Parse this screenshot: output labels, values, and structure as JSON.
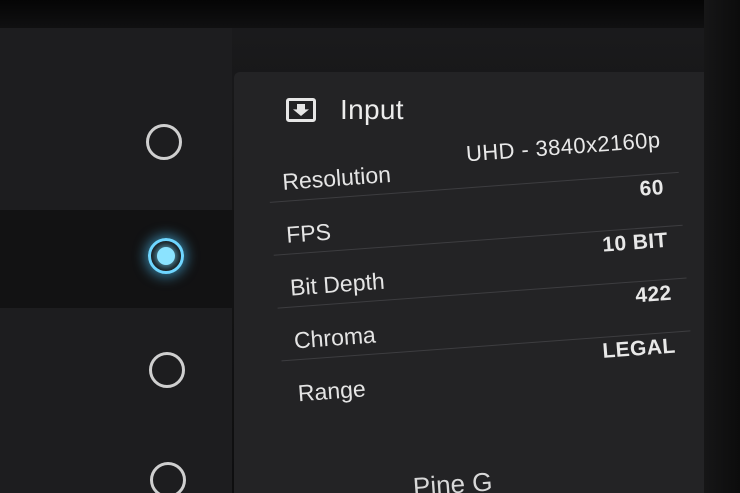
{
  "panel": {
    "title": "Input",
    "icon": "input-download-icon"
  },
  "settings": [
    {
      "label": "Resolution",
      "value": "UHD - 3840x2160p"
    },
    {
      "label": "FPS",
      "value": "60"
    },
    {
      "label": "Bit Depth",
      "value": "10 BIT"
    },
    {
      "label": "Chroma",
      "value": "422"
    },
    {
      "label": "Range",
      "value": "LEGAL"
    }
  ],
  "radio_selector": {
    "options": 4,
    "selected_index": 1
  },
  "footer": {
    "partial_label": "Pine G"
  },
  "colors": {
    "accent": "#6fd6ff",
    "panel_bg": "#232325",
    "text": "#e8e8e8"
  }
}
